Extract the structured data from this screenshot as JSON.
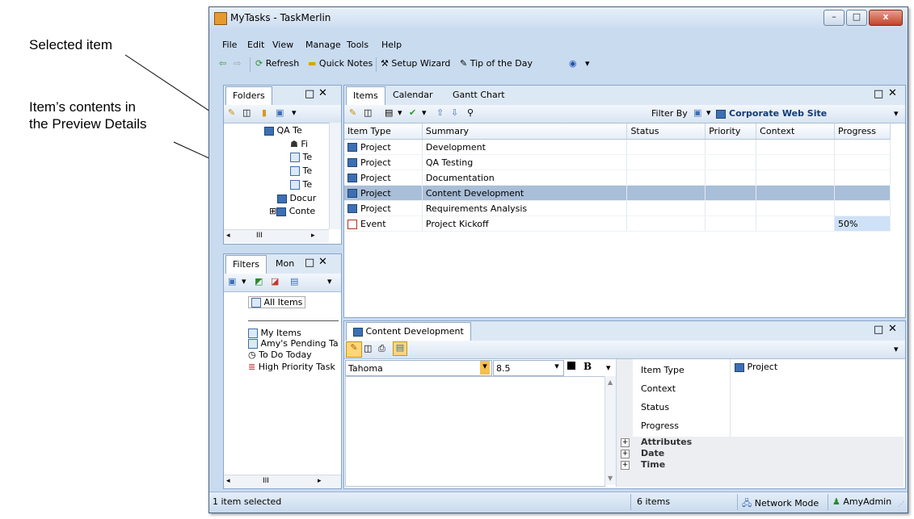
{
  "callouts": [
    {
      "text": "Selected item"
    },
    {
      "text": "Item’s contents in\nthe Preview Details"
    }
  ],
  "window": {
    "title": "MyTasks - TaskMerlin",
    "buttons": {
      "minimize": "–",
      "maximize": "□",
      "close": "x"
    }
  },
  "menu": [
    "File",
    "Edit",
    "View",
    "Manage",
    "Tools",
    "Help"
  ],
  "toolbar": {
    "refresh": "Refresh",
    "quick_notes": "Quick Notes",
    "setup_wizard": "Setup Wizard",
    "tip_of_day": "Tip of the Day"
  },
  "folders_panel": {
    "tab": "Folders",
    "tree": [
      "QA Te",
      "Fi",
      "Te",
      "Te",
      "Te",
      "Docur",
      "Conte"
    ]
  },
  "filters_panel": {
    "tabs": [
      "Filters",
      "Mon"
    ],
    "items": [
      "All Items",
      "My Items",
      "Amy's Pending Ta",
      "To Do Today",
      "High Priority Task"
    ]
  },
  "items_panel": {
    "tabs": [
      "Items",
      "Calendar",
      "Gantt Chart"
    ],
    "filter_by_label": "Filter By",
    "filter_value": "Corporate Web Site",
    "columns": [
      "Item Type",
      "Summary",
      "Status",
      "Priority",
      "Context",
      "Progress"
    ],
    "rows": [
      {
        "type": "Project",
        "summary": "Development",
        "progress": ""
      },
      {
        "type": "Project",
        "summary": "QA Testing",
        "progress": ""
      },
      {
        "type": "Project",
        "summary": "Documentation",
        "progress": ""
      },
      {
        "type": "Project",
        "summary": "Content Development",
        "progress": "",
        "selected": true
      },
      {
        "type": "Project",
        "summary": "Requirements Analysis",
        "progress": ""
      },
      {
        "type": "Event",
        "summary": "Project Kickoff",
        "progress": "50%"
      }
    ]
  },
  "preview": {
    "tab": "Content Development",
    "font": "Tahoma",
    "size": "8.5",
    "bold": "B",
    "props": {
      "item_type_label": "Item Type",
      "item_type_value": "Project",
      "context_label": "Context",
      "status_label": "Status",
      "progress_label": "Progress",
      "groups": [
        "Attributes",
        "Date",
        "Time"
      ]
    }
  },
  "status": {
    "left": "1 item selected",
    "count": "6 items",
    "mode": "Network Mode",
    "user": "AmyAdmin"
  },
  "colors": {
    "selected_row": "#a9bed8",
    "window_frame": "#c9dbef",
    "progress_fill": "#cfe1f7"
  }
}
